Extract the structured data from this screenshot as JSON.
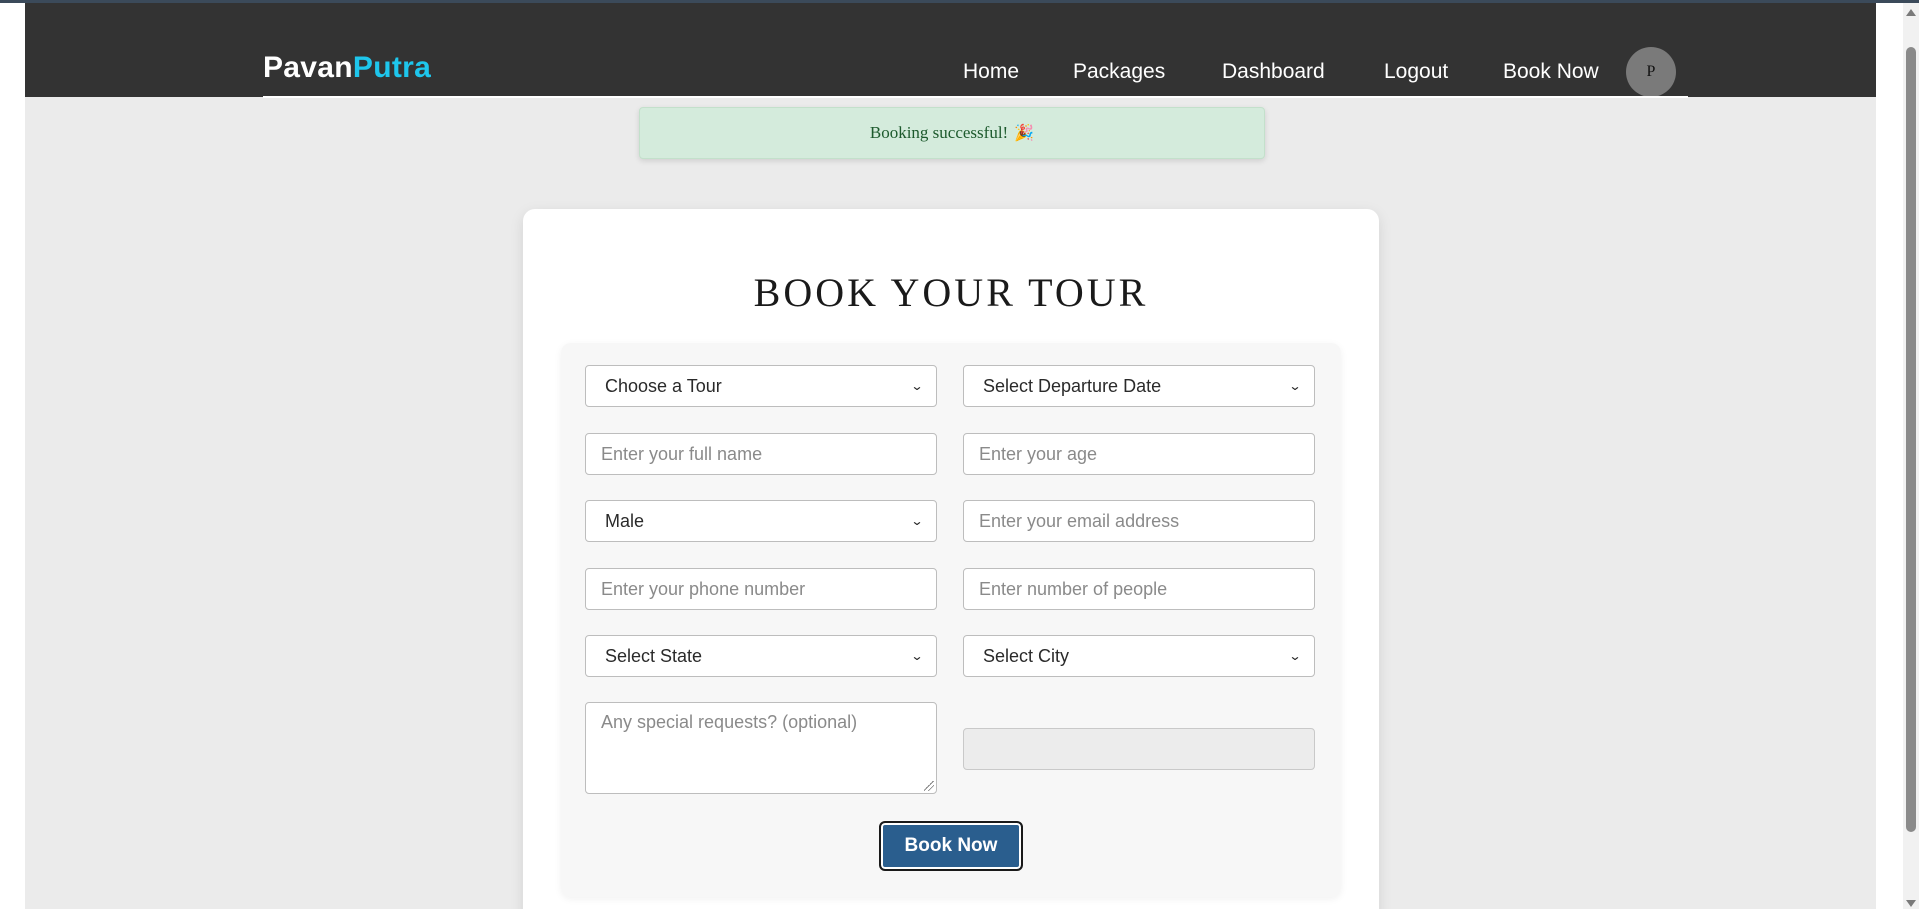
{
  "brand": {
    "part1": "Pavan",
    "part2": "Putra"
  },
  "nav": {
    "items": [
      "Home",
      "Packages",
      "Dashboard",
      "Logout",
      "Book Now"
    ],
    "avatar_initial": "P"
  },
  "alert": {
    "message": "Booking successful!",
    "emoji": "🎉"
  },
  "form": {
    "title": "BOOK YOUR TOUR",
    "tour_select": "Choose a Tour",
    "departure_select": "Select Departure Date",
    "name_placeholder": "Enter your full name",
    "age_placeholder": "Enter your age",
    "gender_select": "Male",
    "email_placeholder": "Enter your email address",
    "phone_placeholder": "Enter your phone number",
    "people_placeholder": "Enter number of people",
    "state_select": "Select State",
    "city_select": "Select City",
    "requests_placeholder": "Any special requests? (optional)",
    "disabled_field_value": "",
    "submit_label": "Book Now"
  },
  "colors": {
    "navbar": "#333333",
    "brand_accent": "#1ec6ec",
    "alert_bg": "#d4ebdc",
    "submit_bg": "#2a5e8e"
  }
}
